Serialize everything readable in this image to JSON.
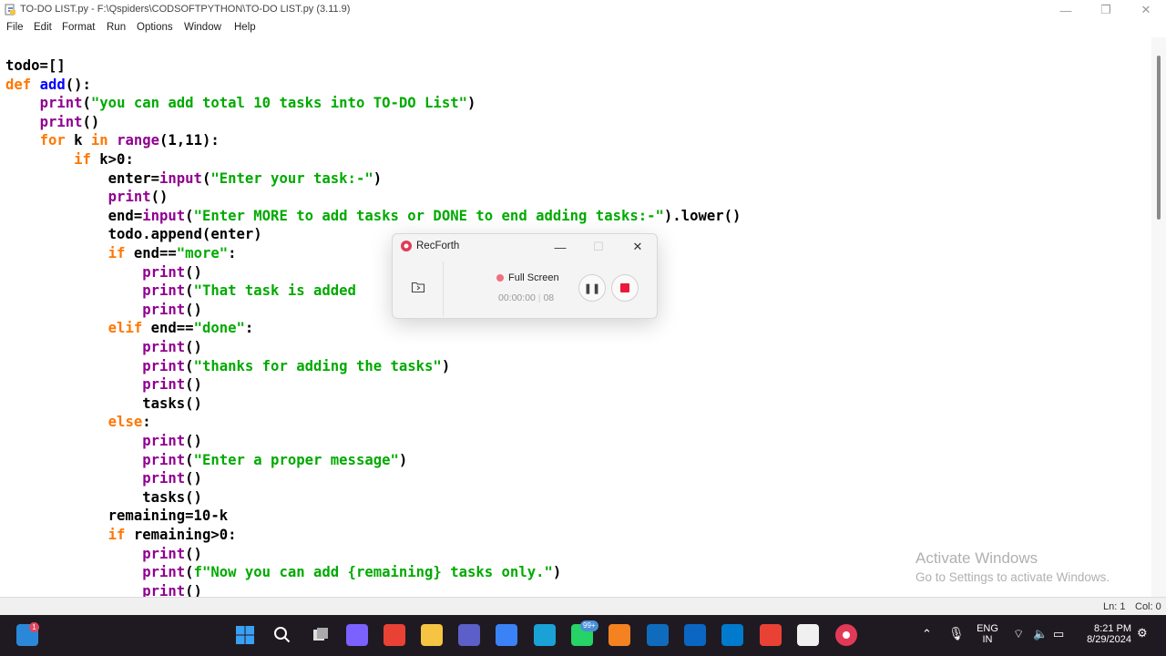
{
  "window": {
    "title": "TO-DO LIST.py - F:\\Qspiders\\CODSOFTPYTHON\\TO-DO LIST.py (3.11.9)",
    "controls": [
      "—",
      "❐",
      "✕"
    ]
  },
  "menu": [
    "File",
    "Edit",
    "Format",
    "Run",
    "Options",
    "Window",
    "Help"
  ],
  "code": [
    [
      [
        "n",
        "todo=[]"
      ]
    ],
    [
      [
        "k",
        "def "
      ],
      [
        "d",
        "add"
      ],
      [
        "n",
        "():"
      ]
    ],
    [
      [
        "n",
        "    "
      ],
      [
        "b",
        "print"
      ],
      [
        "n",
        "("
      ],
      [
        "s",
        "\"you can add total 10 tasks into TO-DO List\""
      ],
      [
        "n",
        ")"
      ]
    ],
    [
      [
        "n",
        "    "
      ],
      [
        "b",
        "print"
      ],
      [
        "n",
        "()"
      ]
    ],
    [
      [
        "n",
        "    "
      ],
      [
        "k",
        "for"
      ],
      [
        "n",
        " k "
      ],
      [
        "k",
        "in"
      ],
      [
        "n",
        " "
      ],
      [
        "b",
        "range"
      ],
      [
        "n",
        "(1,11):"
      ]
    ],
    [
      [
        "n",
        "        "
      ],
      [
        "k",
        "if"
      ],
      [
        "n",
        " k>0:"
      ]
    ],
    [
      [
        "n",
        "            enter="
      ],
      [
        "b",
        "input"
      ],
      [
        "n",
        "("
      ],
      [
        "s",
        "\"Enter your task:-\""
      ],
      [
        "n",
        ")"
      ]
    ],
    [
      [
        "n",
        "            "
      ],
      [
        "b",
        "print"
      ],
      [
        "n",
        "()"
      ]
    ],
    [
      [
        "n",
        "            end="
      ],
      [
        "b",
        "input"
      ],
      [
        "n",
        "("
      ],
      [
        "s",
        "\"Enter MORE to add tasks or DONE to end adding tasks:-\""
      ],
      [
        "n",
        ").lower()"
      ]
    ],
    [
      [
        "n",
        "            todo.append(enter)"
      ]
    ],
    [
      [
        "n",
        "            "
      ],
      [
        "k",
        "if"
      ],
      [
        "n",
        " end=="
      ],
      [
        "s",
        "\"more\""
      ],
      [
        "n",
        ":"
      ]
    ],
    [
      [
        "n",
        "                "
      ],
      [
        "b",
        "print"
      ],
      [
        "n",
        "()"
      ]
    ],
    [
      [
        "n",
        "                "
      ],
      [
        "b",
        "print"
      ],
      [
        "n",
        "("
      ],
      [
        "s",
        "\"That task is added"
      ]
    ],
    [
      [
        "n",
        "                "
      ],
      [
        "b",
        "print"
      ],
      [
        "n",
        "()"
      ]
    ],
    [
      [
        "n",
        "            "
      ],
      [
        "k",
        "elif"
      ],
      [
        "n",
        " end=="
      ],
      [
        "s",
        "\"done\""
      ],
      [
        "n",
        ":"
      ]
    ],
    [
      [
        "n",
        "                "
      ],
      [
        "b",
        "print"
      ],
      [
        "n",
        "()"
      ]
    ],
    [
      [
        "n",
        "                "
      ],
      [
        "b",
        "print"
      ],
      [
        "n",
        "("
      ],
      [
        "s",
        "\"thanks for adding the tasks\""
      ],
      [
        "n",
        ")"
      ]
    ],
    [
      [
        "n",
        "                "
      ],
      [
        "b",
        "print"
      ],
      [
        "n",
        "()"
      ]
    ],
    [
      [
        "n",
        "                tasks()"
      ]
    ],
    [
      [
        "n",
        "            "
      ],
      [
        "k",
        "else"
      ],
      [
        "n",
        ":"
      ]
    ],
    [
      [
        "n",
        "                "
      ],
      [
        "b",
        "print"
      ],
      [
        "n",
        "()"
      ]
    ],
    [
      [
        "n",
        "                "
      ],
      [
        "b",
        "print"
      ],
      [
        "n",
        "("
      ],
      [
        "s",
        "\"Enter a proper message\""
      ],
      [
        "n",
        ")"
      ]
    ],
    [
      [
        "n",
        "                "
      ],
      [
        "b",
        "print"
      ],
      [
        "n",
        "()"
      ]
    ],
    [
      [
        "n",
        "                tasks()"
      ]
    ],
    [
      [
        "n",
        "            remaining=10-k"
      ]
    ],
    [
      [
        "n",
        "            "
      ],
      [
        "k",
        "if"
      ],
      [
        "n",
        " remaining>0:"
      ]
    ],
    [
      [
        "n",
        "                "
      ],
      [
        "b",
        "print"
      ],
      [
        "n",
        "()"
      ]
    ],
    [
      [
        "n",
        "                "
      ],
      [
        "b",
        "print"
      ],
      [
        "n",
        "("
      ],
      [
        "s",
        "f\"Now you can add {remaining} tasks only.\""
      ],
      [
        "n",
        ")"
      ]
    ],
    [
      [
        "n",
        "                "
      ],
      [
        "b",
        "print"
      ],
      [
        "n",
        "()"
      ]
    ]
  ],
  "status": {
    "line": "Ln: 1",
    "col": "Col: 0"
  },
  "watermark": {
    "line1": "Activate Windows",
    "line2": "Go to Settings to activate Windows."
  },
  "recforth": {
    "title": "RecForth",
    "mode": "Full Screen",
    "timer": "00:00:00",
    "timer_suffix": "08",
    "controls": [
      "—",
      "☐",
      "✕"
    ]
  },
  "taskbar": {
    "icons": [
      {
        "name": "widgets-icon",
        "color": "#2b88d8"
      },
      {
        "name": "start-icon",
        "color": "#3aa0f3"
      },
      {
        "name": "search-icon",
        "color": "transparent"
      },
      {
        "name": "task-view-icon",
        "color": "transparent"
      },
      {
        "name": "copilot-icon",
        "color": "#7b61ff"
      },
      {
        "name": "chrome-icon",
        "color": "#e94235"
      },
      {
        "name": "file-explorer-icon",
        "color": "#f6c443"
      },
      {
        "name": "teams-icon",
        "color": "#5b5fc7"
      },
      {
        "name": "store-icon",
        "color": "#3b82f6"
      },
      {
        "name": "edge-icon",
        "color": "#1aa2d6"
      },
      {
        "name": "whatsapp-icon",
        "color": "#25d366"
      },
      {
        "name": "vlc-icon",
        "color": "#f58220"
      },
      {
        "name": "outlook-icon",
        "color": "#0f6cbd"
      },
      {
        "name": "linkedin-icon",
        "color": "#0a66c2"
      },
      {
        "name": "vscode-icon",
        "color": "#007acc"
      },
      {
        "name": "chrome2-icon",
        "color": "#e94235"
      },
      {
        "name": "python-idle-icon",
        "color": "#f0f0f0"
      },
      {
        "name": "recforth-icon",
        "color": "#e23a56"
      }
    ],
    "widgets_badge": "1",
    "whatsapp_badge": "99+",
    "lang_top": "ENG",
    "lang_bottom": "IN",
    "time": "8:21 PM",
    "date": "8/29/2024"
  }
}
